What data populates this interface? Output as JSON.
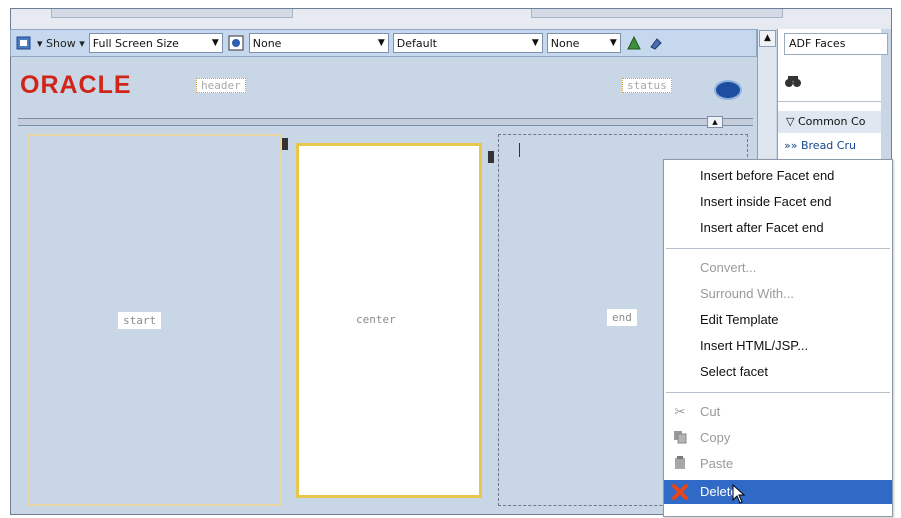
{
  "toolbar": {
    "show_label": "Show",
    "screen_size": "Full Screen Size",
    "select_none_1": "None",
    "select_default": "Default",
    "select_none_2": "None"
  },
  "header": {
    "logo_text": "ORACLE",
    "header_facet": "header",
    "status_facet": "status"
  },
  "panes": {
    "start": "start",
    "center": "center",
    "end": "end"
  },
  "right_panel": {
    "dropdown": "ADF Faces",
    "section": "Common Co",
    "item": "Bread Cru"
  },
  "context_menu": {
    "items": [
      {
        "label": "Insert before Facet  end"
      },
      {
        "label": "Insert inside Facet  end"
      },
      {
        "label": "Insert after Facet  end"
      },
      {
        "label": "Convert..."
      },
      {
        "label": "Surround With..."
      },
      {
        "label": "Edit Template"
      },
      {
        "label": "Insert HTML/JSP..."
      },
      {
        "label": "Select facet"
      },
      {
        "label": "Cut"
      },
      {
        "label": "Copy"
      },
      {
        "label": "Paste"
      },
      {
        "label": "Delete"
      }
    ]
  },
  "colors": {
    "oracle_red": "#d1251a",
    "highlight": "#3169c6",
    "facet_border": "#e7c84a"
  }
}
